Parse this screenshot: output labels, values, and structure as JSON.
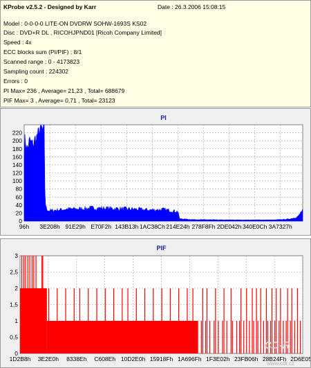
{
  "info": {
    "title": "KProbe v2.5.2 - Designed by Karr",
    "date": "Date : 26.3.2006 15:08:15",
    "lines": [
      "Model : 0-0-0-0 LITE-ON DVDRW SOHW-1693S KS02",
      "Disc : DVD+R DL , RICOHJPND01 [Ricoh Company Limited]",
      "Speed : 4x",
      "ECC blocks sum (PI/PIF) : 8/1",
      "Scanned range : 0 - 4173823",
      "Sampling count : 224302",
      "Errors : 0",
      "PI Max= 236 , Average= 21,23 , Total= 688679",
      "PIF Max= 3 , Average= 0,71 , Total= 23123"
    ]
  },
  "watermark": {
    "line1": "CD-R",
    "line2": "www.cdr.cz"
  },
  "chart_data": [
    {
      "type": "area",
      "title": "PI",
      "color": "#0000ff",
      "ylim": [
        0,
        240
      ],
      "yticks": [
        0,
        20,
        40,
        60,
        80,
        100,
        120,
        140,
        160,
        180,
        200,
        220
      ],
      "xtick_labels": [
        "96h",
        "3E208h",
        "91E29h",
        "E70F2h",
        "143B13h",
        "1AC38Ch",
        "214E24h",
        "278F8Fh",
        "2DE042h",
        "340E0Ch",
        "3A7327h"
      ],
      "grid": true,
      "profile": [
        [
          0.0,
          190
        ],
        [
          0.004,
          205
        ],
        [
          0.01,
          180
        ],
        [
          0.02,
          200
        ],
        [
          0.03,
          190
        ],
        [
          0.04,
          205
        ],
        [
          0.05,
          215
        ],
        [
          0.058,
          236
        ],
        [
          0.066,
          225
        ],
        [
          0.072,
          232
        ],
        [
          0.075,
          50
        ],
        [
          0.08,
          30
        ],
        [
          0.09,
          26
        ],
        [
          0.12,
          28
        ],
        [
          0.15,
          30
        ],
        [
          0.2,
          31
        ],
        [
          0.25,
          33
        ],
        [
          0.3,
          32
        ],
        [
          0.35,
          31
        ],
        [
          0.4,
          30
        ],
        [
          0.45,
          28
        ],
        [
          0.5,
          29
        ],
        [
          0.54,
          25
        ],
        [
          0.553,
          24
        ],
        [
          0.557,
          6
        ],
        [
          0.6,
          4
        ],
        [
          0.7,
          3
        ],
        [
          0.8,
          3
        ],
        [
          0.9,
          3
        ],
        [
          0.95,
          5
        ],
        [
          0.975,
          9
        ],
        [
          0.985,
          13
        ],
        [
          0.99,
          18
        ],
        [
          0.995,
          24
        ],
        [
          1.0,
          26
        ]
      ]
    },
    {
      "type": "bar",
      "title": "PIF",
      "color": "#ff0000",
      "ylim": [
        0,
        3
      ],
      "yticks": [
        0,
        0.5,
        1,
        1.5,
        2,
        2.5,
        3
      ],
      "ytick_labels": [
        "0",
        "0,5",
        "1",
        "1,5",
        "2",
        "2,5",
        "3"
      ],
      "xtick_labels": [
        "1D2B8h",
        "3E2E0h",
        "8338Eh",
        "C608Eh",
        "10D2E0h",
        "15918Fh",
        "1A696Fh",
        "1F3E02h",
        "23FB06h",
        "28B24Fh",
        "2D6E05h"
      ],
      "grid": true,
      "base": [
        [
          0.0,
          2
        ],
        [
          0.095,
          1
        ],
        [
          0.63,
          0
        ]
      ],
      "spikes_to_3": [
        0.005,
        0.012,
        0.018,
        0.026,
        0.033,
        0.041,
        0.047,
        0.055,
        0.076,
        0.079
      ],
      "spikes_to_2": [
        0.1,
        0.13,
        0.16,
        0.19,
        0.21,
        0.24,
        0.27,
        0.3,
        0.33,
        0.36,
        0.38,
        0.41,
        0.44,
        0.47,
        0.5,
        0.53,
        0.56,
        0.59,
        0.61,
        0.645,
        0.66,
        0.69,
        0.72,
        0.745,
        0.78,
        0.8,
        0.82,
        0.835,
        0.85,
        0.87,
        0.89,
        0.905,
        0.92,
        0.945,
        0.96,
        0.98
      ],
      "spikes_to_1": [
        0.64,
        0.655,
        0.67,
        0.685,
        0.7,
        0.715,
        0.73,
        0.75,
        0.765,
        0.775,
        0.79,
        0.81,
        0.825,
        0.84,
        0.86,
        0.875,
        0.885,
        0.9,
        0.915,
        0.93,
        0.94,
        0.955,
        0.97,
        0.99
      ]
    }
  ]
}
